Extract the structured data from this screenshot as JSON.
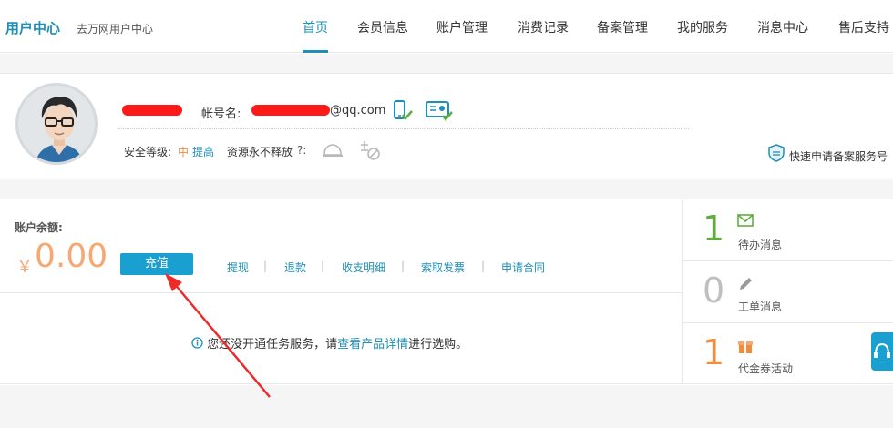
{
  "header": {
    "brand_title": "用户中心",
    "brand_subtitle": "去万网用户中心",
    "nav": [
      "首页",
      "会员信息",
      "账户管理",
      "消费记录",
      "备案管理",
      "我的服务",
      "消息中心",
      "售后支持"
    ],
    "active_nav": "首页"
  },
  "profile": {
    "account_label": "帐号名:",
    "account_suffix": "@qq.com",
    "security_label": "安全等级:",
    "security_level": "中",
    "security_link": "提高",
    "resource_label": "资源永不释放",
    "resource_help": "?:",
    "quick_link": "快速申请备案服务号"
  },
  "balance": {
    "label": "账户余额:",
    "currency": "￥",
    "amount": "0.00",
    "recharge": "充值",
    "actions": [
      "提现",
      "退款",
      "收支明细",
      "索取发票",
      "申请合同"
    ],
    "separator": "|",
    "notice_prefix": "您还没开通任务服务，请",
    "notice_link": "查看产品详情",
    "notice_suffix": "进行选购。"
  },
  "stats": [
    {
      "num": "1",
      "label": "待办消息",
      "icon": "mail-icon",
      "color": "#5fae3c"
    },
    {
      "num": "0",
      "label": "工单消息",
      "icon": "pencil-icon",
      "color": "#bfbfbf"
    },
    {
      "num": "1",
      "label": "代金券活动",
      "icon": "gift-icon",
      "color": "#f08c3c"
    }
  ],
  "colors": {
    "accent": "#1f8fb5",
    "button": "#1aa0d0",
    "balance": "#f5a872",
    "annotation": "#ee2a2a"
  }
}
